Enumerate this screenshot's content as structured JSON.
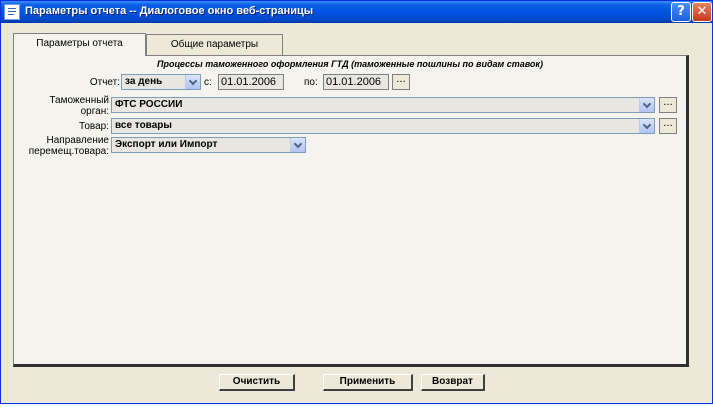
{
  "window": {
    "title": "Параметры отчета -- Диалоговое окно веб-страницы",
    "help_glyph": "?",
    "close_glyph": "✕"
  },
  "tabs": [
    {
      "label": "Параметры отчета",
      "active": true
    },
    {
      "label": "Общие параметры",
      "active": false
    }
  ],
  "form": {
    "heading": "Процессы таможенного оформления ГТД (таможенные пошлины по видам ставок)",
    "report_label": "Отчет:",
    "report_value": "за день",
    "from_label": "с:",
    "from_date": "01.01.2006",
    "to_label": "по:",
    "to_date": "01.01.2006",
    "customs_label_line1": "Таможенный",
    "customs_label_line2": "орган:",
    "customs_value": "ФТС РОССИИ",
    "goods_label": "Товар:",
    "goods_value": "все товары",
    "direction_label_line1": "Направление",
    "direction_label_line2": "перемещ.товара:",
    "direction_value": "Экспорт или Импорт",
    "ellipsis": "..."
  },
  "buttons": {
    "clear": "Очистить",
    "apply": "Применить",
    "back": "Возврат"
  },
  "colors": {
    "titlebar": "#0054e3",
    "window_bg": "#ece9d8",
    "panel_bg": "#f4f3ee"
  },
  "icons": {
    "app": "document-icon",
    "help": "help-icon",
    "close": "close-icon",
    "dropdown": "chevron-down-icon"
  }
}
